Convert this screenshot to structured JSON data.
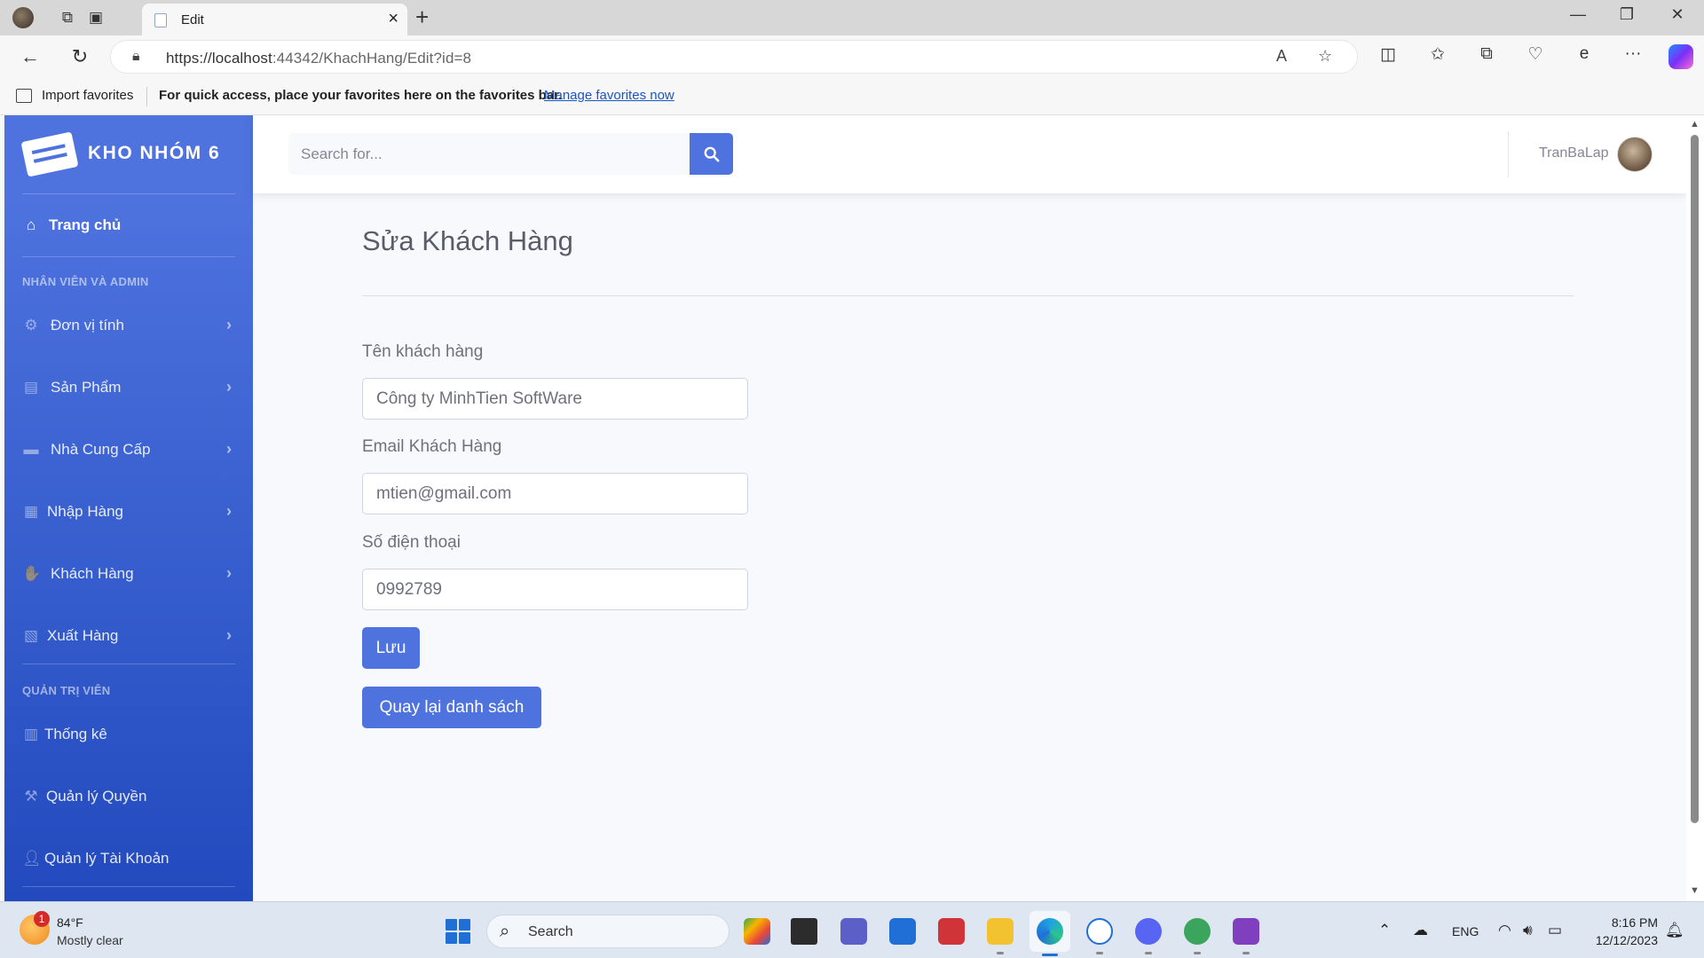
{
  "browser": {
    "tab_title": "Edit",
    "url_host": "https://localhost",
    "url_rest": ":44342/KhachHang/Edit?id=8",
    "favorites": {
      "import_label": "Import favorites",
      "message": "For quick access, place your favorites here on the favorites bar.",
      "manage_link": "Manage favorites now"
    }
  },
  "sidebar": {
    "brand": "KHO NHÓM 6",
    "home": {
      "label": "Trang chủ",
      "icon": "home-icon"
    },
    "section1_heading": "NHÂN VIÊN VÀ ADMIN",
    "items": [
      {
        "label": "Đơn vị tính",
        "icon": "cog-icon"
      },
      {
        "label": "Sản Phẩm",
        "icon": "dolly-icon"
      },
      {
        "label": "Nhà Cung Cấp",
        "icon": "truck-icon"
      },
      {
        "label": "Nhập Hàng",
        "icon": "import-icon"
      },
      {
        "label": "Khách Hàng",
        "icon": "handshake-icon"
      },
      {
        "label": "Xuất Hàng",
        "icon": "export-icon"
      }
    ],
    "section2_heading": "QUẢN TRỊ VIÊN",
    "admin_items": [
      {
        "label": "Thống kê",
        "icon": "calculator-icon"
      },
      {
        "label": "Quản lý Quyền",
        "icon": "gavel-icon"
      },
      {
        "label": "Quản lý Tài Khoản",
        "icon": "user-icon"
      }
    ]
  },
  "topbar": {
    "search_placeholder": "Search for...",
    "username": "TranBaLap"
  },
  "form": {
    "title": "Sửa Khách Hàng",
    "name_label": "Tên khách hàng",
    "name_value": "Công ty MinhTien SoftWare",
    "email_label": "Email Khách Hàng",
    "email_value": "mtien@gmail.com",
    "phone_label": "Số điện thoại",
    "phone_value": "0992789",
    "save_label": "Lưu",
    "back_label": "Quay lại danh sách"
  },
  "taskbar": {
    "weather_temp": "84°F",
    "weather_desc": "Mostly clear",
    "weather_badge": "1",
    "search_label": "Search",
    "lang": "ENG",
    "time": "8:16 PM",
    "date": "12/12/2023"
  },
  "colors": {
    "primary": "#4e73df",
    "sidebar_gradient_end": "#224abe"
  }
}
